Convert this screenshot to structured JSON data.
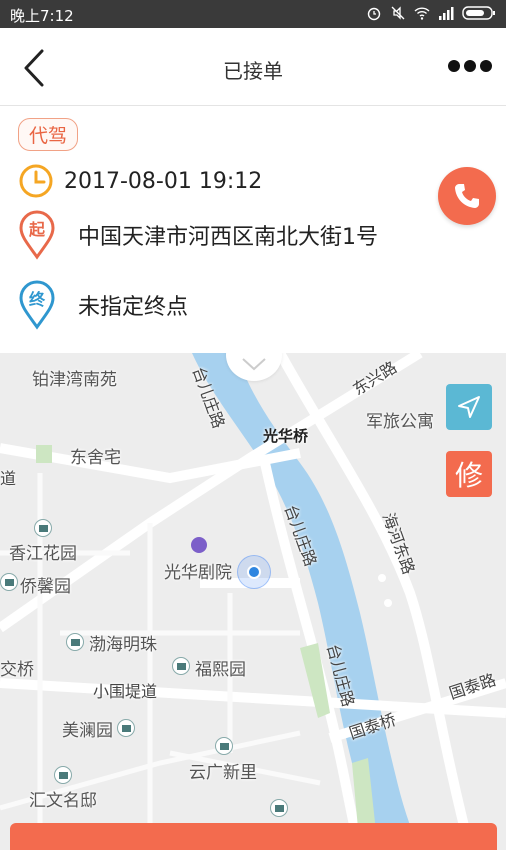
{
  "status_bar": {
    "time": "晚上7:12",
    "icons": [
      "alarm-icon",
      "mute-icon",
      "wifi-icon",
      "signal-icon",
      "battery-icon"
    ]
  },
  "nav": {
    "title": "已接单",
    "back_icon": "chevron-left-icon",
    "more_icon": "more-dots-icon"
  },
  "order": {
    "tag": "代驾",
    "time": "2017-08-01 19:12",
    "start_badge": "起",
    "start_address": "中国天津市河西区南北大街1号",
    "end_badge": "终",
    "end_address": "未指定终点"
  },
  "map": {
    "fix_label": "修",
    "labels": {
      "bojinwan": "铂津湾南苑",
      "dongshezhai": "东舍宅",
      "junlv": "军旅公寓",
      "dongxing": "东兴路",
      "guanghuaqiao": "光华桥",
      "taierzhuang1": "台儿庄路",
      "taierzhuang2": "台儿庄路",
      "taierzhuang3": "台儿庄路",
      "haihedong": "海河东路",
      "dao": "道",
      "xiangjiang": "香江花园",
      "qiaoxin": "侨馨园",
      "guanghuajuyuan": "光华剧院",
      "bohai": "渤海明珠",
      "jiaoqiao": "交桥",
      "fuxi": "福熙园",
      "xiaoweidi": "小围堤道",
      "guotai_road": "国泰路",
      "guotai_bridge": "国泰桥",
      "meilan": "美澜园",
      "yunguang": "云广新里",
      "huiwen": "汇文名邸"
    }
  },
  "colors": {
    "accent": "#f36b4e",
    "river": "#a7d1ef",
    "locate_button": "#5bb8d4"
  }
}
